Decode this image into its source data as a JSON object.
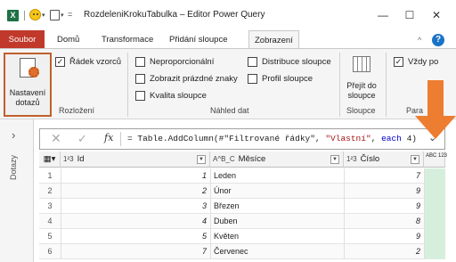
{
  "window": {
    "app_logo": "X",
    "title": "RozdeleniKrokuTabulka – Editor Power Query",
    "minimize": "—",
    "maximize": "☐",
    "close": "✕"
  },
  "tabs": [
    {
      "label": "Soubor"
    },
    {
      "label": "Domů"
    },
    {
      "label": "Transformace"
    },
    {
      "label": "Přidání sloupce"
    },
    {
      "label": "Zobrazení"
    }
  ],
  "ribbon": {
    "query_settings": {
      "label_line1": "Nastavení",
      "label_line2": "dotazů"
    },
    "formula_bar": {
      "label": "Řádek vzorců",
      "checked": true
    },
    "layout_group": "Rozložení",
    "preview_options": [
      {
        "label": "Neproporcionální",
        "checked": false
      },
      {
        "label": "Zobrazit prázdné znaky",
        "checked": false
      },
      {
        "label": "Kvalita sloupce",
        "checked": false
      },
      {
        "label": "Distribuce sloupce",
        "checked": false
      },
      {
        "label": "Profil sloupce",
        "checked": false
      }
    ],
    "preview_group": "Náhled dat",
    "goto_column": {
      "label_line1": "Přejít do",
      "label_line2": "sloupce"
    },
    "column_group": "Sloupce",
    "always_allow": {
      "label": "Vždy po",
      "checked": true
    },
    "params_group": "Para"
  },
  "queries_pane": {
    "label": "Dotazy",
    "chevron": "›"
  },
  "formula": {
    "fx": "fx",
    "prefix": "= Table.AddColumn(#\"Filtrované řádky\", ",
    "string": "\"Vlastní\"",
    "mid": ", ",
    "keyword": "each",
    "suffix": " 4)"
  },
  "columns": [
    {
      "type": "1²3",
      "name": "Id"
    },
    {
      "type": "A^B_C",
      "name": "Měsíce"
    },
    {
      "type": "1²3",
      "name": "Číslo"
    },
    {
      "type": "ABC 123",
      "name": ""
    }
  ],
  "rows": [
    {
      "idx": "1",
      "id": "1",
      "mesic": "Leden",
      "cislo": "7"
    },
    {
      "idx": "2",
      "id": "2",
      "mesic": "Únor",
      "cislo": "9"
    },
    {
      "idx": "3",
      "id": "3",
      "mesic": "Březen",
      "cislo": "9"
    },
    {
      "idx": "4",
      "id": "4",
      "mesic": "Duben",
      "cislo": "8"
    },
    {
      "idx": "5",
      "id": "5",
      "mesic": "Květen",
      "cislo": "9"
    },
    {
      "idx": "6",
      "id": "7",
      "mesic": "Červenec",
      "cislo": "2"
    }
  ],
  "colors": {
    "file_tab": "#c0392b",
    "highlight": "#c0602b",
    "arrow": "#ed7d31",
    "new_column": "#d6efdc"
  }
}
